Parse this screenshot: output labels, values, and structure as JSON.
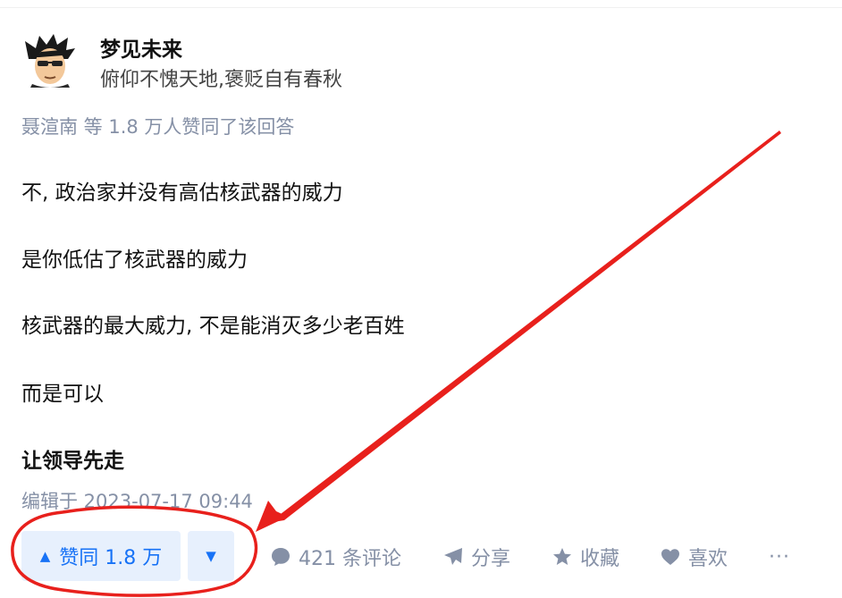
{
  "author": {
    "name": "梦见未来",
    "bio": "俯仰不愧天地,褒贬自有春秋"
  },
  "upvoters_line": "聂渲南 等 1.8 万人赞同了该回答",
  "content": {
    "p1": "不, 政治家并没有高估核武器的威力",
    "p2": "是你低估了核武器的威力",
    "p3": "核武器的最大威力, 不是能消灭多少老百姓",
    "p4": "而是可以",
    "p5": "让领导先走"
  },
  "edited": "编辑于 2023-07-17 09:44",
  "actions": {
    "upvote_label": "赞同 1.8 万",
    "upvote_icon": "▲",
    "downvote_icon": "▼",
    "comment_label": "421 条评论",
    "share_label": "分享",
    "collect_label": "收藏",
    "like_label": "喜欢",
    "more_label": "···"
  },
  "colors": {
    "primary": "#1772f6",
    "primary_bg": "#e7f0fd",
    "meta_text": "#8590a6",
    "annotation_red": "#e8201c"
  }
}
